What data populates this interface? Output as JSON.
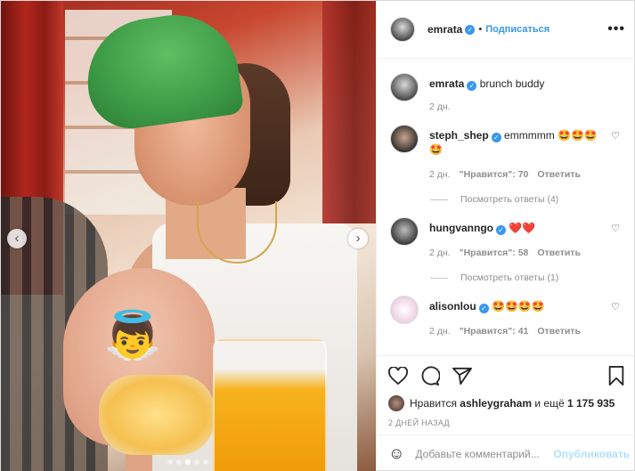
{
  "post": {
    "username": "emrata",
    "follow_label": "Подписаться",
    "more_label": "•••",
    "caption_user": "emrata",
    "caption_text": "brunch buddy",
    "caption_time": "2 дн.",
    "photo": {
      "overlay_emoji": "👼",
      "nav_prev": "‹",
      "nav_next": "›",
      "page_dots": 5,
      "active_dot": 3
    }
  },
  "comments": [
    {
      "user": "steph_shep",
      "text": "emmmmm 🤩🤩🤩🤩",
      "time": "2 дн.",
      "likes": "\"Нравится\": 70",
      "reply": "Ответить",
      "view_replies": "Посмотреть ответы (4)"
    },
    {
      "user": "hungvanngo",
      "text": "❤️❤️",
      "time": "2 дн.",
      "likes": "\"Нравится\": 58",
      "reply": "Ответить",
      "view_replies": "Посмотреть ответы (1)"
    },
    {
      "user": "alisonlou",
      "text": "🤩🤩🤩🤩",
      "time": "2 дн.",
      "likes": "\"Нравится\": 41",
      "reply": "Ответить"
    }
  ],
  "actions": {
    "likes_prefix": "Нравится",
    "likes_user": "ashleygraham",
    "likes_and": "и ещё",
    "likes_count": "1 175 935",
    "date": "2 ДНЕЙ НАЗАД"
  },
  "add_comment": {
    "placeholder": "Добавьте комментарий...",
    "post_label": "Опубликовать"
  }
}
